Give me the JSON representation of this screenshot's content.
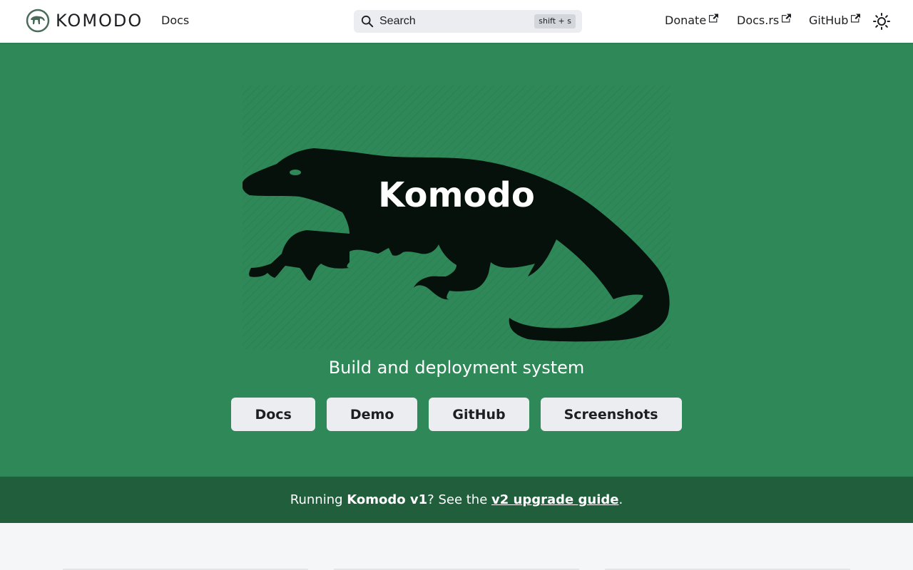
{
  "navbar": {
    "brand_title": "KOMODO",
    "docs_link": "Docs",
    "search": {
      "placeholder": "Search",
      "shortcut": "shift + s"
    },
    "right_links": [
      {
        "label": "Donate",
        "external": true
      },
      {
        "label": "Docs.rs",
        "external": true
      },
      {
        "label": "GitHub",
        "external": true
      }
    ],
    "theme_icon": "sun-icon"
  },
  "hero": {
    "title": "Komodo",
    "subtitle": "Build and deployment system",
    "buttons": [
      {
        "label": "Docs"
      },
      {
        "label": "Demo"
      },
      {
        "label": "GitHub"
      },
      {
        "label": "Screenshots"
      }
    ],
    "background_color": "#2f8858",
    "image": "komodo-lizard-silhouette"
  },
  "banner": {
    "prefix": "Running ",
    "version": "Komodo v1",
    "middle": "? See the ",
    "link": "v2 upgrade guide",
    "suffix": "."
  },
  "colors": {
    "accent": "#2f8858",
    "banner": "#215e3c",
    "button_bg": "#ebedf0"
  }
}
